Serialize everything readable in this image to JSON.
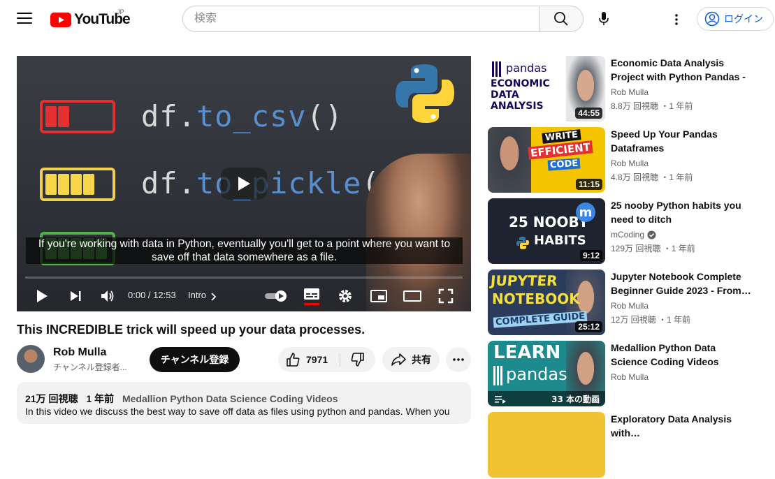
{
  "header": {
    "logo_text": "YouTube",
    "region": "JP",
    "search_placeholder": "検索",
    "login_label": "ログイン"
  },
  "player": {
    "code_line_1_prefix": "df.",
    "code_line_1_fn": "to_csv",
    "code_line_1_suffix": "()",
    "code_line_2_prefix": "df.",
    "code_line_2_fn": "to_pickle",
    "code_line_2_suffix": "()",
    "caption_line_1": "If you're working with data in Python, eventually you'll get to a point where you want to",
    "caption_line_2": "save off that data somewhere as a file.",
    "time": "0:00 / 12:53",
    "chapter": "Intro",
    "progress": 0
  },
  "video": {
    "title": "This INCREDIBLE trick will speed up your data processes.",
    "channel_name": "Rob Mulla",
    "subscribers": "チャンネル登録者...",
    "subscribe_label": "チャンネル登録",
    "likes": "7971",
    "share_label": "共有"
  },
  "description": {
    "views": "21万 回視聴",
    "age": "1 年前",
    "playlist": "Medallion Python Data Science Coding Videos",
    "text": "In this video we discuss the best way to save off data as files using python and pandas. When you"
  },
  "recommendations": [
    {
      "title": "Economic Data Analysis Project with Python Pandas - Data…",
      "channel": "Rob Mulla",
      "verified": false,
      "meta": "8.8万 回視聴 ・1 年前",
      "duration": "44:55",
      "thumb_lines": [
        "pandas",
        "ECONOMIC",
        "DATA",
        "ANALYSIS"
      ]
    },
    {
      "title": "Speed Up Your Pandas Dataframes",
      "channel": "Rob Mulla",
      "verified": false,
      "meta": "4.8万 回視聴 ・1 年前",
      "duration": "11:15",
      "thumb_lines": [
        "WRITE",
        "EFFICIENT",
        "CODE"
      ]
    },
    {
      "title": "25 nooby Python habits you need to ditch",
      "channel": "mCoding",
      "verified": true,
      "meta": "129万 回視聴 ・1 年前",
      "duration": "9:12",
      "thumb_lines": [
        "25 NOOBY",
        "HABITS",
        "m"
      ]
    },
    {
      "title": "Jupyter Notebook Complete Beginner Guide 2023 - From…",
      "channel": "Rob Mulla",
      "verified": false,
      "meta": "12万 回視聴 ・1 年前",
      "duration": "25:12",
      "thumb_lines": [
        "JUPYTER",
        "NOTEBOOK",
        "COMPLETE GUIDE"
      ]
    },
    {
      "title": "Medallion Python Data Science Coding Videos",
      "channel": "Rob Mulla",
      "verified": false,
      "meta": "",
      "duration": "33 本の動画",
      "thumb_lines": [
        "LEARN",
        "pandas"
      ]
    },
    {
      "title": "Exploratory Data Analysis with…",
      "channel": "",
      "verified": false,
      "meta": "",
      "duration": "",
      "thumb_lines": []
    }
  ],
  "colors": {
    "brand_red": "#ff0000",
    "link_blue": "#065fd4",
    "python_blue": "#3776ab",
    "python_yellow": "#ffd43b"
  }
}
